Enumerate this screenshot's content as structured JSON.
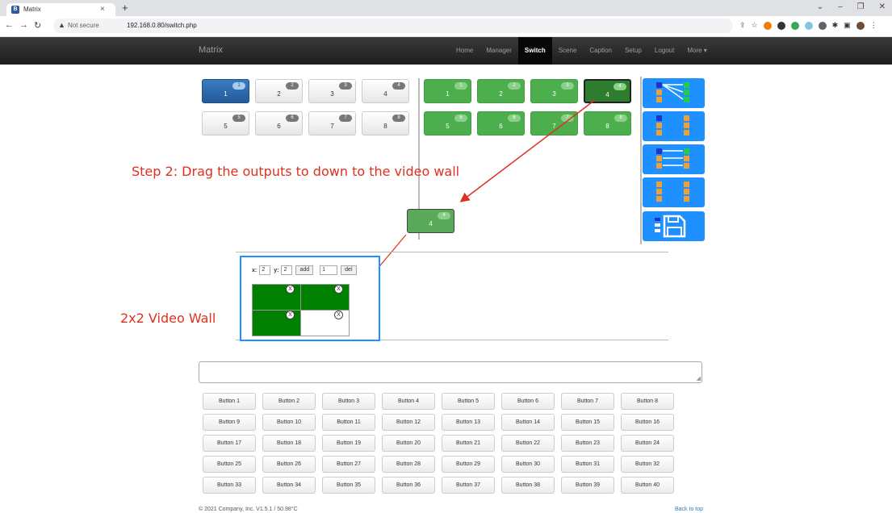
{
  "browser": {
    "tab_title": "Matrix",
    "tab_close": "×",
    "new_tab": "+",
    "favicon_letter": "B",
    "url_warning": "Not secure",
    "url": "192.168.0.80/switch.php"
  },
  "navbar": {
    "brand": "Matrix",
    "items": [
      "Home",
      "Manager",
      "Switch",
      "Scene",
      "Caption",
      "Setup",
      "Logout",
      "More ▾"
    ],
    "active": "Switch"
  },
  "inputs": [
    {
      "label": "1",
      "badge": "1",
      "selected": true
    },
    {
      "label": "2",
      "badge": "2",
      "selected": false
    },
    {
      "label": "3",
      "badge": "3",
      "selected": false
    },
    {
      "label": "4",
      "badge": "4",
      "selected": false
    },
    {
      "label": "5",
      "badge": "5",
      "selected": false
    },
    {
      "label": "6",
      "badge": "6",
      "selected": false
    },
    {
      "label": "7",
      "badge": "7",
      "selected": false
    },
    {
      "label": "8",
      "badge": "8",
      "selected": false
    }
  ],
  "outputs": [
    {
      "label": "1",
      "badge": "1",
      "selected": false
    },
    {
      "label": "2",
      "badge": "2",
      "selected": false
    },
    {
      "label": "3",
      "badge": "3",
      "selected": false
    },
    {
      "label": "4",
      "badge": "4",
      "selected": true
    },
    {
      "label": "5",
      "badge": "5",
      "selected": false
    },
    {
      "label": "6",
      "badge": "6",
      "selected": false
    },
    {
      "label": "7",
      "badge": "7",
      "selected": false
    },
    {
      "label": "8",
      "badge": "8",
      "selected": false
    }
  ],
  "dragged_tile": {
    "label": "4",
    "badge": "4"
  },
  "annotations": {
    "step2": "Step 2: Drag the outputs to down to the video wall",
    "wall": "2x2 Video Wall"
  },
  "video_wall": {
    "x_label": "x:",
    "x_value": "2",
    "y_label": "y:",
    "y_value": "2",
    "add_label": "add",
    "del_value": "1",
    "del_label": "del",
    "cell_close": "X"
  },
  "buttons": [
    "Button 1",
    "Button 2",
    "Button 3",
    "Button 4",
    "Button 5",
    "Button 6",
    "Button 7",
    "Button 8",
    "Button 9",
    "Button 10",
    "Button 11",
    "Button 12",
    "Button 13",
    "Button 14",
    "Button 15",
    "Button 16",
    "Button 17",
    "Button 18",
    "Button 19",
    "Button 20",
    "Button 21",
    "Button 22",
    "Button 23",
    "Button 24",
    "Button 25",
    "Button 26",
    "Button 27",
    "Button 28",
    "Button 29",
    "Button 30",
    "Button 31",
    "Button 32",
    "Button 33",
    "Button 34",
    "Button 35",
    "Button 36",
    "Button 37",
    "Button 38",
    "Button 39",
    "Button 40"
  ],
  "footer": {
    "copyright": "© 2021 Company, Inc. V1.5.1 / 50.98°C",
    "back_to_top": "Back to top"
  },
  "colors": {
    "accent": "#1e90ff",
    "output_green": "#4cae4c",
    "wall_green": "#008000",
    "annotation_red": "#e03020"
  }
}
